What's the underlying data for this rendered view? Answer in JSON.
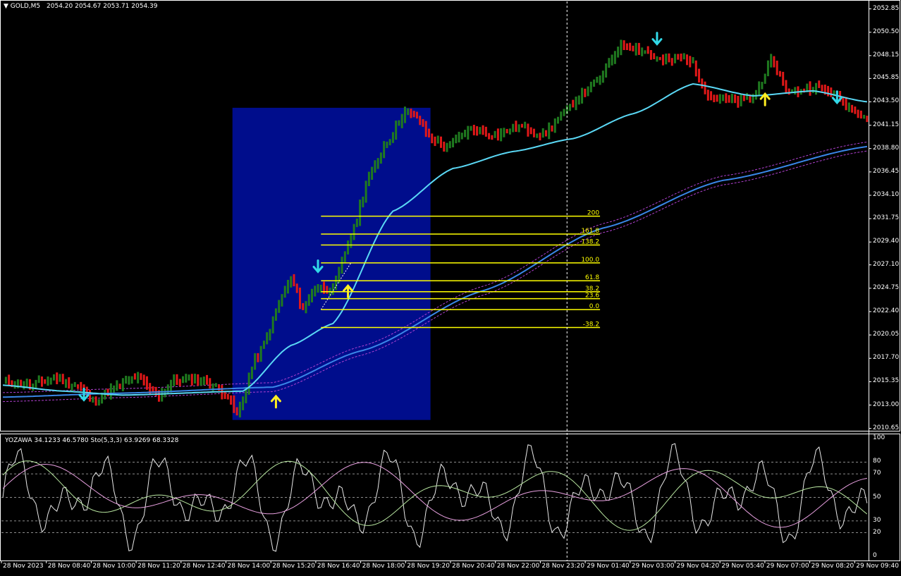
{
  "header": {
    "symbol": "GOLD,M5",
    "ohlc": "2054.20 2054.67 2053.71 2054.39"
  },
  "indicator_header": "YOZAWA 34.1233 46.5780  Sto(5,3,3) 63.9269 68.3328",
  "colors": {
    "background": "#000000",
    "grid": "#ffffff",
    "bull_bar": "#1f7a1f",
    "bear_bar": "#e01818",
    "range_box": "#000d8c",
    "fib": "#ffff00",
    "ma_fast": "#5ad8f5",
    "ma_slow": "#3a86e8",
    "envelope": "#b040d0",
    "arrow_down": "#31d9e8",
    "arrow_up": "#ffee22",
    "osc_white": "#e8e8e8",
    "osc_green": "#b8e6a0",
    "osc_pink": "#e8a0e0"
  },
  "chart_data": [
    {
      "type": "candlestick",
      "title": "GOLD,M5",
      "y_axis": {
        "ylim": [
          2010.2,
          2053.6
        ],
        "ticks": [
          "2052.85",
          "2050.50",
          "2048.15",
          "2045.85",
          "2043.50",
          "2041.15",
          "2038.80",
          "2036.45",
          "2034.10",
          "2031.75",
          "2029.40",
          "2027.10",
          "2024.75",
          "2022.40",
          "2020.05",
          "2017.70",
          "2015.35",
          "2013.00",
          "2010.65"
        ]
      },
      "x_axis": {
        "ticks": [
          "28 Nov 2023",
          "28 Nov 08:40",
          "28 Nov 10:00",
          "28 Nov 11:20",
          "28 Nov 12:40",
          "28 Nov 14:00",
          "28 Nov 15:20",
          "28 Nov 16:40",
          "28 Nov 18:00",
          "28 Nov 19:20",
          "28 Nov 20:40",
          "28 Nov 22:00",
          "28 Nov 23:20",
          "29 Nov 01:40",
          "29 Nov 03:00",
          "29 Nov 04:20",
          "29 Nov 05:40",
          "29 Nov 07:00",
          "29 Nov 08:20",
          "29 Nov 09:40"
        ]
      },
      "price_anchors": [
        [
          0,
          2015.3
        ],
        [
          10,
          2015.0
        ],
        [
          17,
          2015.8
        ],
        [
          24,
          2015.0
        ],
        [
          30,
          2013.5
        ],
        [
          38,
          2014.8
        ],
        [
          44,
          2015.8
        ],
        [
          52,
          2014.0
        ],
        [
          58,
          2015.6
        ],
        [
          66,
          2015.6
        ],
        [
          74,
          2014.3
        ],
        [
          78,
          2012.0
        ],
        [
          84,
          2017.5
        ],
        [
          96,
          2025.6
        ],
        [
          100,
          2022.8
        ],
        [
          104,
          2024.8
        ],
        [
          110,
          2024.6
        ],
        [
          116,
          2030.0
        ],
        [
          122,
          2036.0
        ],
        [
          128,
          2039.5
        ],
        [
          134,
          2042.5
        ],
        [
          138,
          2042.0
        ],
        [
          142,
          2040.0
        ],
        [
          148,
          2039.0
        ],
        [
          156,
          2040.8
        ],
        [
          164,
          2040.2
        ],
        [
          172,
          2041.0
        ],
        [
          180,
          2040.2
        ],
        [
          186,
          2042.0
        ],
        [
          192,
          2044.0
        ],
        [
          198,
          2045.5
        ],
        [
          206,
          2049.3
        ],
        [
          214,
          2048.6
        ],
        [
          220,
          2047.5
        ],
        [
          228,
          2048.0
        ],
        [
          236,
          2044.0
        ],
        [
          244,
          2043.5
        ],
        [
          250,
          2044.0
        ],
        [
          256,
          2047.5
        ],
        [
          262,
          2044.5
        ],
        [
          270,
          2045.0
        ],
        [
          276,
          2044.5
        ],
        [
          282,
          2043.0
        ],
        [
          288,
          2042.0
        ]
      ],
      "ma_fast_anchors": [
        [
          0,
          2015.0
        ],
        [
          20,
          2014.4
        ],
        [
          40,
          2014.0
        ],
        [
          80,
          2014.4
        ],
        [
          96,
          2019.0
        ],
        [
          110,
          2021.2
        ],
        [
          130,
          2032.5
        ],
        [
          150,
          2036.8
        ],
        [
          170,
          2038.5
        ],
        [
          190,
          2039.8
        ],
        [
          210,
          2042.3
        ],
        [
          230,
          2045.3
        ],
        [
          250,
          2044.1
        ],
        [
          270,
          2044.6
        ],
        [
          288,
          2043.5
        ]
      ],
      "ma_slow_anchors": [
        [
          0,
          2013.8
        ],
        [
          40,
          2014.2
        ],
        [
          90,
          2014.8
        ],
        [
          120,
          2018.5
        ],
        [
          160,
          2024.5
        ],
        [
          200,
          2030.8
        ],
        [
          240,
          2035.6
        ],
        [
          288,
          2039.0
        ]
      ],
      "range_box": {
        "start_bar": 77,
        "end_bar": 143,
        "high": 2042.9,
        "low": 2011.5
      },
      "fibonacci": {
        "start_bar": 106,
        "end_bar": 199,
        "levels": [
          {
            "label": "200",
            "price": 2032.0
          },
          {
            "label": "161.8",
            "price": 2030.2
          },
          {
            "label": "138.2",
            "price": 2029.1
          },
          {
            "label": "100.0",
            "price": 2027.3
          },
          {
            "label": "61.8",
            "price": 2025.5
          },
          {
            "label": "38.2",
            "price": 2024.4
          },
          {
            "label": "23.6",
            "price": 2023.7
          },
          {
            "label": "0.0",
            "price": 2022.6
          },
          {
            "label": "-38.2",
            "price": 2020.8
          }
        ]
      },
      "signals": [
        {
          "bar": 27,
          "price": 2014.0,
          "direction": "down"
        },
        {
          "bar": 91,
          "price": 2013.4,
          "direction": "up"
        },
        {
          "bar": 105,
          "price": 2026.9,
          "direction": "down"
        },
        {
          "bar": 115,
          "price": 2024.5,
          "direction": "up"
        },
        {
          "bar": 218,
          "price": 2049.8,
          "direction": "down"
        },
        {
          "bar": 254,
          "price": 2043.8,
          "direction": "up"
        },
        {
          "bar": 278,
          "price": 2043.9,
          "direction": "down"
        }
      ],
      "crosshair_bar": 188
    },
    {
      "type": "line",
      "title": "YOZAWA 34.1233 46.5780  Sto(5,3,3) 63.9269 68.3328",
      "ylim": [
        0,
        100
      ],
      "y_ticks": [
        "100",
        "80",
        "70",
        "50",
        "30",
        "20",
        "0"
      ],
      "levels": [
        80,
        70,
        50,
        30,
        20
      ],
      "series": [
        {
          "name": "Sto(5,3,3)",
          "color": "#e8e8e8"
        },
        {
          "name": "YOZAWA",
          "color": "#b8e6a0"
        },
        {
          "name": "YOZAWA",
          "color": "#e8a0e0"
        }
      ]
    }
  ]
}
